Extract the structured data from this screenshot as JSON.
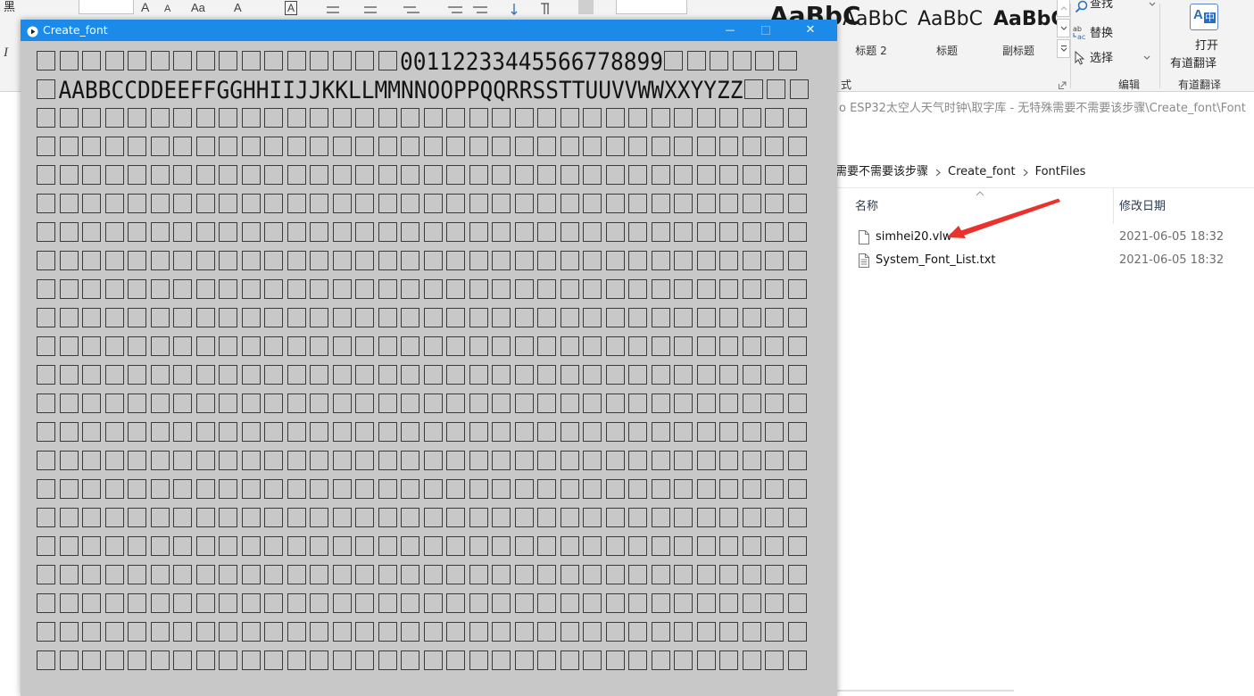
{
  "word_ribbon": {
    "font_name_fragment": "黑",
    "italic_glyph": "I",
    "top_glyphs": [
      "A",
      "A",
      "Aa",
      "A",
      "A"
    ],
    "heading_sample": "AaBbC",
    "styles": [
      {
        "sample": "AaBbC",
        "label": "标题 2",
        "bold": false
      },
      {
        "sample": "AaBbC",
        "label": "标题",
        "bold": false
      },
      {
        "sample": "AaBbC",
        "label": "副标题",
        "bold": true
      }
    ],
    "styles_group_label": "式",
    "editing": {
      "find": "查找",
      "replace": "替换",
      "replace_icon_letters": [
        "ab",
        "ac"
      ],
      "select": "选择",
      "group_label": "编辑"
    },
    "youdao": {
      "icon_letters": [
        "A",
        "中"
      ],
      "open_line1": "打开",
      "open_line2": "有道翻译",
      "group_label": "有道翻译"
    },
    "icons": [
      "search-icon",
      "replace-icon",
      "select-cursor-icon",
      "translate-icon",
      "dialog-launcher-icon"
    ]
  },
  "app_window": {
    "title": "Create_font",
    "title_bar_color": "#1c8ae8",
    "canvas_color": "#c8c8c8",
    "controls": {
      "minimize": "—",
      "close": "✕"
    },
    "grid": {
      "rows": [
        [
          {
            "missing_glyphs": 16
          },
          {
            "text": "00112233445566778899"
          },
          {
            "missing_glyphs": 6
          }
        ],
        [
          {
            "missing_glyphs": 1
          },
          {
            "text": "AABBCCDDEEFFGGHHIIJJKKLLMMNNOOPPQQRRSSTTUUVVWWXXYYZZ"
          },
          {
            "missing_glyphs": 3
          }
        ],
        [
          {
            "missing_glyphs": 34
          }
        ],
        [
          {
            "missing_glyphs": 34
          }
        ],
        [
          {
            "missing_glyphs": 34
          }
        ],
        [
          {
            "missing_glyphs": 34
          }
        ],
        [
          {
            "missing_glyphs": 34
          }
        ],
        [
          {
            "missing_glyphs": 34
          }
        ],
        [
          {
            "missing_glyphs": 34
          }
        ],
        [
          {
            "missing_glyphs": 34
          }
        ],
        [
          {
            "missing_glyphs": 34
          }
        ],
        [
          {
            "missing_glyphs": 34
          }
        ],
        [
          {
            "missing_glyphs": 34
          }
        ],
        [
          {
            "missing_glyphs": 34
          }
        ],
        [
          {
            "missing_glyphs": 34
          }
        ],
        [
          {
            "missing_glyphs": 34
          }
        ],
        [
          {
            "missing_glyphs": 34
          }
        ],
        [
          {
            "missing_glyphs": 34
          }
        ],
        [
          {
            "missing_glyphs": 34
          }
        ],
        [
          {
            "missing_glyphs": 34
          }
        ],
        [
          {
            "missing_glyphs": 34
          }
        ],
        [
          {
            "missing_glyphs": 34
          }
        ]
      ]
    }
  },
  "explorer": {
    "window_title": "o ESP32太空人天气时钟\\取字库 - 无特殊需要不需要该步骤\\Create_font\\Font",
    "breadcrumb": [
      "需要不需要该步骤",
      "Create_font",
      "FontFiles"
    ],
    "columns": {
      "name": "名称",
      "modified": "修改日期"
    },
    "files": [
      {
        "name": "simhei20.vlw",
        "modified": "2021-06-05 18:32",
        "icon": "blank-file-icon"
      },
      {
        "name": "System_Font_List.txt",
        "modified": "2021-06-05 18:32",
        "icon": "text-file-icon"
      }
    ],
    "annotation_color": "#e8322b"
  }
}
